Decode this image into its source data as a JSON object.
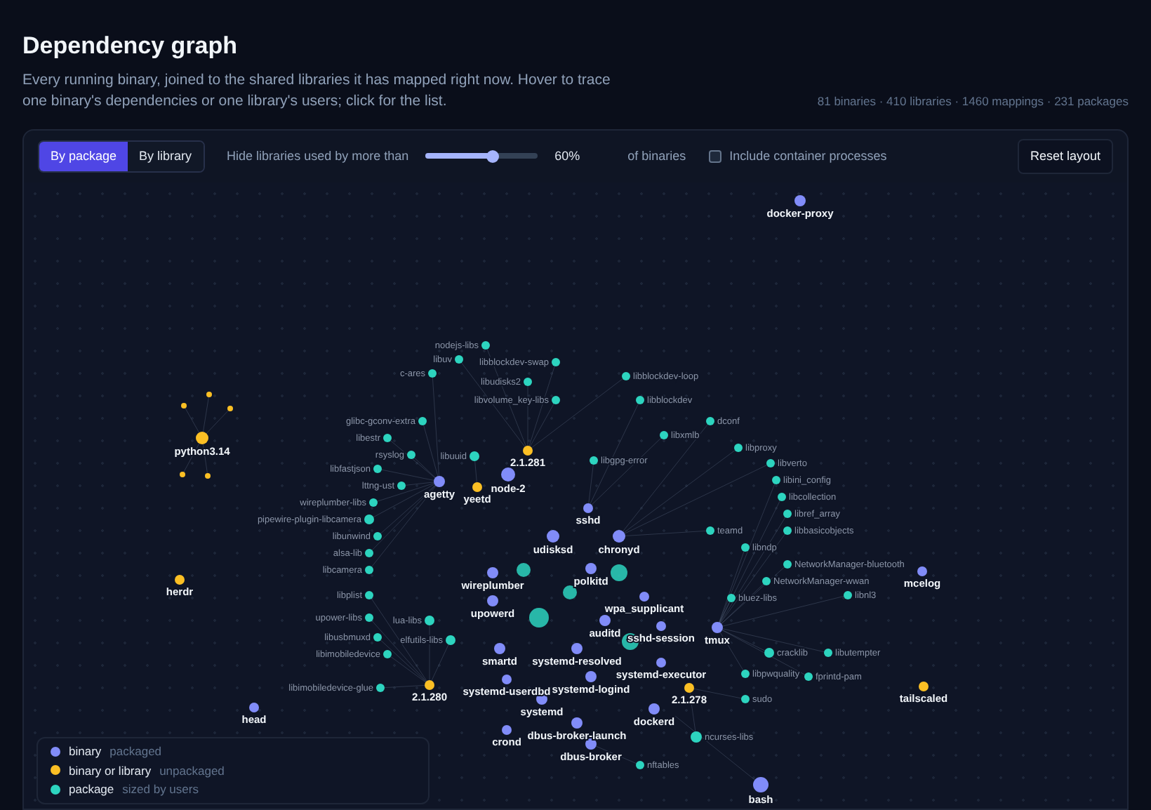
{
  "page": {
    "title": "Dependency graph",
    "description": "Every running binary, joined to the shared libraries it has mapped right now. Hover to trace one binary's dependencies or one library's users; click for the list.",
    "stats": "81 binaries · 410 libraries · 1460 mappings · 231 packages"
  },
  "toolbar": {
    "view_tabs": [
      {
        "label": "By package",
        "selected": true
      },
      {
        "label": "By library",
        "selected": false
      }
    ],
    "threshold": {
      "label": "Hide libraries used by more than",
      "level": 0.6,
      "reading": "60%",
      "suffix": "of binaries"
    },
    "include_containers": {
      "label": "Include container processes",
      "checked": false
    },
    "reset_button": "Reset layout"
  },
  "graph": {
    "nodes": [
      {
        "label": "docker-proxy",
        "kind": "binary"
      },
      {
        "label": "python3.14",
        "kind": "unpackaged"
      },
      {
        "label": "herdr",
        "kind": "unpackaged"
      },
      {
        "label": "head",
        "kind": "binary"
      },
      {
        "label": "mcelog",
        "kind": "binary"
      },
      {
        "label": "tailscaled",
        "kind": "unpackaged"
      },
      {
        "label": "bash",
        "kind": "binary"
      },
      {
        "label": "2.1.281",
        "kind": "unpackaged"
      },
      {
        "label": "2.1.280",
        "kind": "unpackaged"
      },
      {
        "label": "2.1.278",
        "kind": "unpackaged"
      },
      {
        "label": "agetty",
        "kind": "binary"
      },
      {
        "label": "yeetd",
        "kind": "unpackaged"
      },
      {
        "label": "node-2",
        "kind": "binary"
      },
      {
        "label": "udisksd",
        "kind": "binary"
      },
      {
        "label": "sshd",
        "kind": "binary"
      },
      {
        "label": "chronyd",
        "kind": "binary"
      },
      {
        "label": "polkitd",
        "kind": "binary"
      },
      {
        "label": "wireplumber",
        "kind": "binary"
      },
      {
        "label": "wpa_supplicant",
        "kind": "binary"
      },
      {
        "label": "upowerd",
        "kind": "binary"
      },
      {
        "label": "auditd",
        "kind": "binary"
      },
      {
        "label": "sshd-session",
        "kind": "binary"
      },
      {
        "label": "tmux",
        "kind": "binary"
      },
      {
        "label": "smartd",
        "kind": "binary"
      },
      {
        "label": "systemd-resolved",
        "kind": "binary"
      },
      {
        "label": "systemd-executor",
        "kind": "binary"
      },
      {
        "label": "systemd-userdbd",
        "kind": "binary"
      },
      {
        "label": "systemd-logind",
        "kind": "binary"
      },
      {
        "label": "systemd",
        "kind": "binary"
      },
      {
        "label": "dbus-broker-launch",
        "kind": "binary"
      },
      {
        "label": "crond",
        "kind": "binary"
      },
      {
        "label": "dbus-broker",
        "kind": "binary"
      },
      {
        "label": "dockerd",
        "kind": "binary"
      },
      {
        "label": "nodejs-libs",
        "kind": "package"
      },
      {
        "label": "libuv",
        "kind": "package"
      },
      {
        "label": "c-ares",
        "kind": "package"
      },
      {
        "label": "libblockdev-swap",
        "kind": "package"
      },
      {
        "label": "libudisks2",
        "kind": "package"
      },
      {
        "label": "libblockdev-loop",
        "kind": "package"
      },
      {
        "label": "libvolume_key-libs",
        "kind": "package"
      },
      {
        "label": "libblockdev",
        "kind": "package"
      },
      {
        "label": "libgpg-error",
        "kind": "package"
      },
      {
        "label": "libuuid",
        "kind": "package"
      },
      {
        "label": "glibc-gconv-extra",
        "kind": "package"
      },
      {
        "label": "libestr",
        "kind": "package"
      },
      {
        "label": "rsyslog",
        "kind": "package"
      },
      {
        "label": "libfastjson",
        "kind": "package"
      },
      {
        "label": "lttng-ust",
        "kind": "package"
      },
      {
        "label": "wireplumber-libs",
        "kind": "package"
      },
      {
        "label": "pipewire-plugin-libcamera",
        "kind": "package"
      },
      {
        "label": "libunwind",
        "kind": "package"
      },
      {
        "label": "alsa-lib",
        "kind": "package"
      },
      {
        "label": "libcamera",
        "kind": "package"
      },
      {
        "label": "libplist",
        "kind": "package"
      },
      {
        "label": "upower-libs",
        "kind": "package"
      },
      {
        "label": "libusbmuxd",
        "kind": "package"
      },
      {
        "label": "libimobiledevice",
        "kind": "package"
      },
      {
        "label": "libimobiledevice-glue",
        "kind": "package"
      },
      {
        "label": "lua-libs",
        "kind": "package"
      },
      {
        "label": "elfutils-libs",
        "kind": "package"
      },
      {
        "label": "dconf",
        "kind": "package"
      },
      {
        "label": "libxmlb",
        "kind": "package"
      },
      {
        "label": "libproxy",
        "kind": "package"
      },
      {
        "label": "libverto",
        "kind": "package"
      },
      {
        "label": "libini_config",
        "kind": "package"
      },
      {
        "label": "libcollection",
        "kind": "package"
      },
      {
        "label": "libref_array",
        "kind": "package"
      },
      {
        "label": "teamd",
        "kind": "package"
      },
      {
        "label": "libbasicobjects",
        "kind": "package"
      },
      {
        "label": "libndp",
        "kind": "package"
      },
      {
        "label": "NetworkManager-bluetooth",
        "kind": "package"
      },
      {
        "label": "NetworkManager-wwan",
        "kind": "package"
      },
      {
        "label": "bluez-libs",
        "kind": "package"
      },
      {
        "label": "libnl3",
        "kind": "package"
      },
      {
        "label": "cracklib",
        "kind": "package"
      },
      {
        "label": "libutempter",
        "kind": "package"
      },
      {
        "label": "libpwquality",
        "kind": "package"
      },
      {
        "label": "fprintd-pam",
        "kind": "package"
      },
      {
        "label": "sudo",
        "kind": "package"
      },
      {
        "label": "ncurses-libs",
        "kind": "package"
      },
      {
        "label": "nftables",
        "kind": "package"
      }
    ]
  },
  "legend": [
    {
      "kind": "binary",
      "name": "binary",
      "note": "packaged"
    },
    {
      "kind": "unpackaged",
      "name": "binary or library",
      "note": "unpackaged"
    },
    {
      "kind": "package",
      "name": "package",
      "note": "sized by users"
    }
  ]
}
